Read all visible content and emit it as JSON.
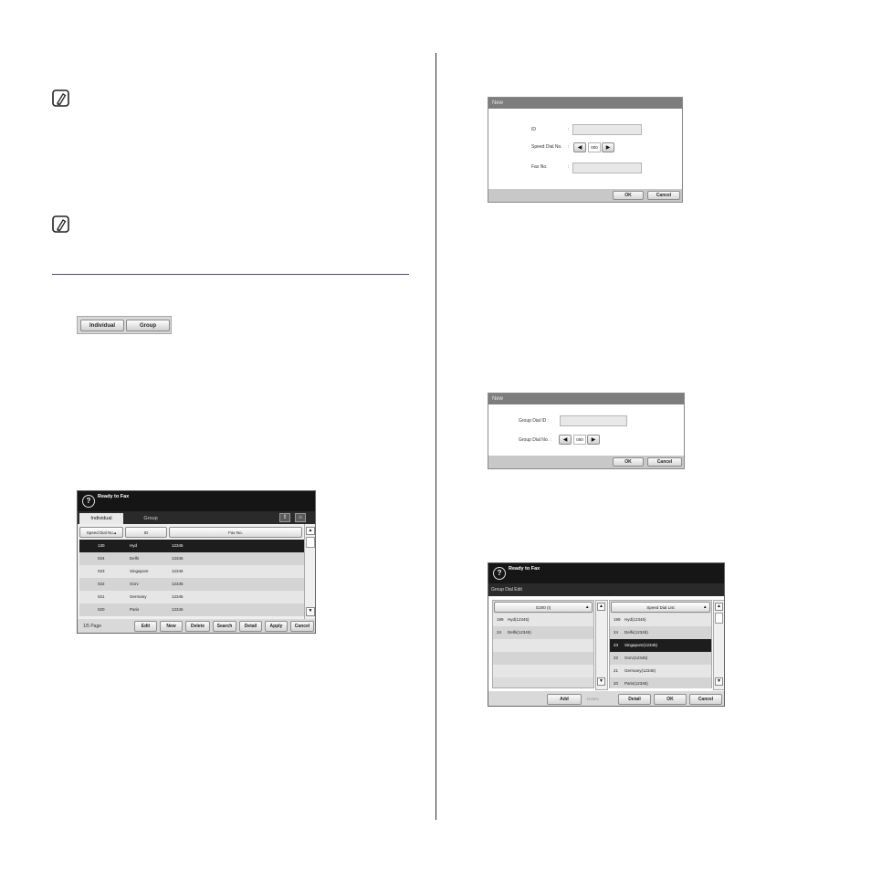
{
  "dialog_new_individual": {
    "title": "New",
    "id_label": "ID",
    "speed_dial_label": "Speed Dial No.",
    "fax_label": "Fax No.",
    "colon": ":",
    "speed_dial_value": "000",
    "ok": "OK",
    "cancel": "Cancel"
  },
  "tabs_image": {
    "individual": "Individual",
    "group": "Group"
  },
  "address_book": {
    "title": "Ready to Fax",
    "tab_individual": "Individual",
    "tab_group": "Group",
    "col_speed": "Speed Dial No.▴",
    "col_id": "ID",
    "col_fax": "Fax No.",
    "rows": [
      {
        "speed": "130",
        "id": "Hyd",
        "fax": "12345"
      },
      {
        "speed": "024",
        "id": "Delhi",
        "fax": "12345"
      },
      {
        "speed": "023",
        "id": "Singapore",
        "fax": "12345"
      },
      {
        "speed": "022",
        "id": "Oorv",
        "fax": "12345"
      },
      {
        "speed": "021",
        "id": "Germany",
        "fax": "12345"
      },
      {
        "speed": "020",
        "id": "Paris",
        "fax": "12345"
      }
    ],
    "page": "1/5 Page",
    "buttons": [
      "Edit",
      "New",
      "Delete",
      "Search",
      "Detail",
      "Apply",
      "Cancel"
    ]
  },
  "dialog_new_group": {
    "title": "New",
    "group_id_label": "Group Dial ID :",
    "group_no_label": "Group Dial No. :",
    "group_no_value": "000",
    "ok": "OK",
    "cancel": "Cancel"
  },
  "group_edit": {
    "title": "Ready to Fax",
    "subtitle": "Group Dial Edit",
    "left_header": "G200 (I)",
    "right_header": "Speed Dial List",
    "left_rows": [
      {
        "num": "199",
        "text": "Hyd(12345)"
      },
      {
        "num": "24",
        "text": "Delhi(12345)"
      }
    ],
    "right_rows": [
      {
        "num": "199",
        "text": "Hyd(12345)"
      },
      {
        "num": "24",
        "text": "Delhi(12345)"
      },
      {
        "num": "23",
        "text": "Singapore(12345)"
      },
      {
        "num": "22",
        "text": "Oorv(12345)"
      },
      {
        "num": "21",
        "text": "Germany(12345)"
      },
      {
        "num": "20",
        "text": "Paris(12345)"
      }
    ],
    "buttons": {
      "add": "Add",
      "delete": "Delete",
      "detail": "Detail",
      "ok": "OK",
      "cancel": "Cancel"
    }
  }
}
